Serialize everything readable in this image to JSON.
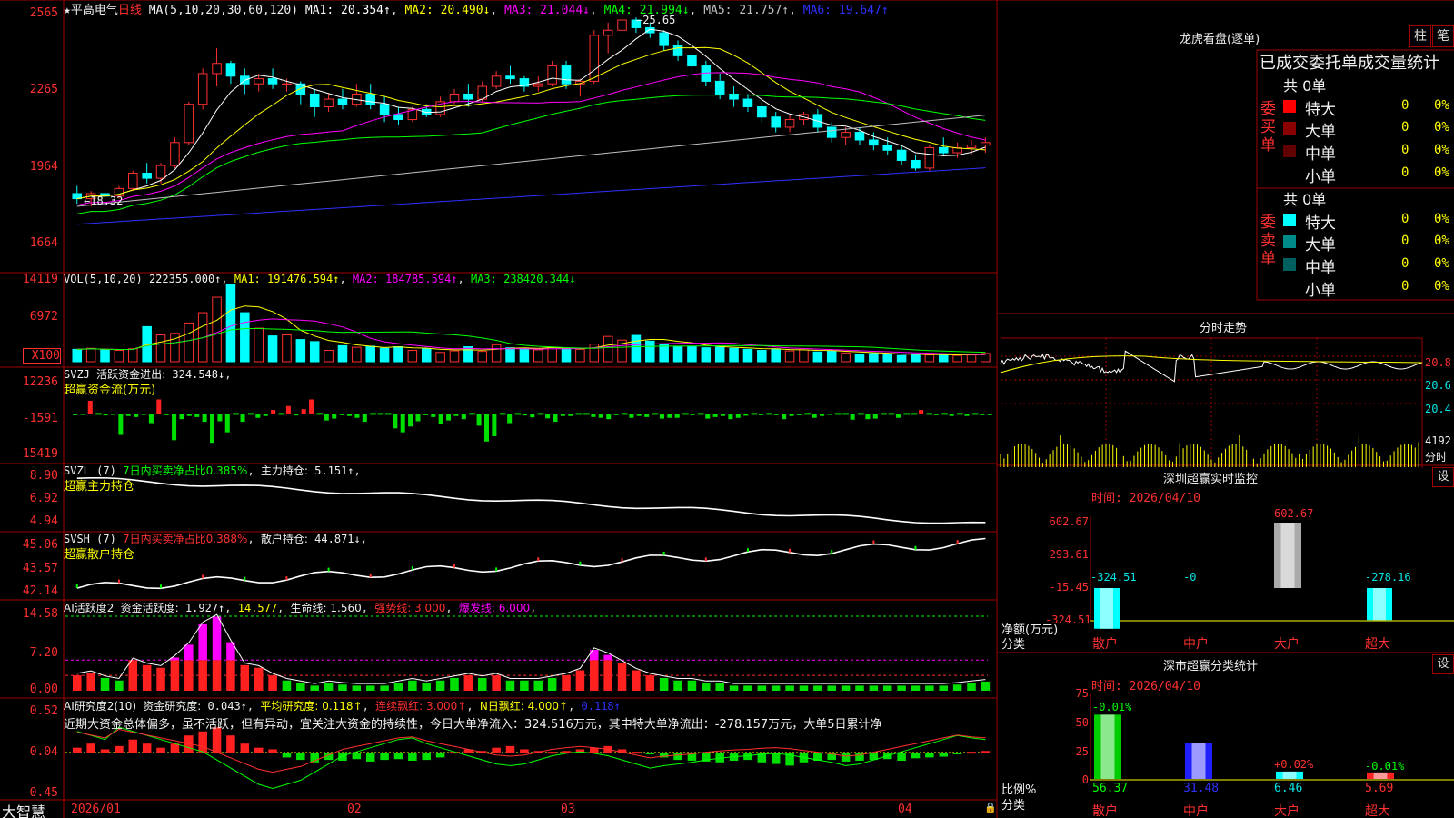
{
  "stock": {
    "star": "★",
    "name": "平高电气",
    "period": "日线"
  },
  "main": {
    "ma_label": "MA(5,10,20,30,60,120)",
    "mas": [
      {
        "label": "MA1: 20.354↑",
        "color": "#ffffff"
      },
      {
        "label": "MA2: 20.490↓",
        "color": "#ffff00"
      },
      {
        "label": "MA3: 21.044↓",
        "color": "#ff00ff"
      },
      {
        "label": "MA4: 21.994↓",
        "color": "#00ff00"
      },
      {
        "label": "MA5: 21.757↑",
        "color": "#c0c0c0"
      },
      {
        "label": "MA6: 19.647↑",
        "color": "#3030ff"
      }
    ],
    "y_ticks": [
      "2565",
      "2265",
      "1964",
      "1664"
    ],
    "high_mark": "25.65",
    "low_mark": "18.32",
    "candles": [
      [
        18.6,
        18.9,
        18.2,
        18.4
      ],
      [
        18.4,
        18.7,
        18.1,
        18.6
      ],
      [
        18.6,
        18.8,
        18.3,
        18.5
      ],
      [
        18.5,
        18.9,
        18.4,
        18.8
      ],
      [
        18.8,
        19.5,
        18.7,
        19.4
      ],
      [
        19.4,
        19.8,
        19.0,
        19.2
      ],
      [
        19.2,
        19.8,
        19.0,
        19.7
      ],
      [
        19.7,
        20.8,
        19.6,
        20.6
      ],
      [
        20.6,
        22.2,
        20.5,
        22.1
      ],
      [
        22.1,
        23.5,
        21.9,
        23.3
      ],
      [
        23.3,
        24.3,
        22.8,
        23.7
      ],
      [
        23.7,
        23.8,
        22.9,
        23.2
      ],
      [
        23.2,
        23.5,
        22.5,
        22.9
      ],
      [
        22.9,
        23.3,
        22.6,
        23.1
      ],
      [
        23.1,
        23.5,
        22.7,
        22.9
      ],
      [
        22.9,
        23.1,
        22.6,
        22.9
      ],
      [
        22.9,
        23.0,
        22.1,
        22.5
      ],
      [
        22.5,
        22.7,
        21.6,
        22.0
      ],
      [
        22.0,
        22.5,
        21.8,
        22.3
      ],
      [
        22.3,
        22.7,
        21.9,
        22.1
      ],
      [
        22.1,
        22.9,
        22.0,
        22.5
      ],
      [
        22.5,
        22.9,
        21.9,
        22.1
      ],
      [
        22.1,
        22.4,
        21.4,
        21.7
      ],
      [
        21.7,
        22.0,
        21.3,
        21.5
      ],
      [
        21.5,
        22.0,
        21.4,
        21.9
      ],
      [
        21.9,
        22.1,
        21.6,
        21.7
      ],
      [
        21.7,
        22.4,
        21.6,
        22.2
      ],
      [
        22.2,
        22.7,
        22.1,
        22.5
      ],
      [
        22.5,
        22.9,
        22.0,
        22.3
      ],
      [
        22.3,
        23.0,
        22.2,
        22.8
      ],
      [
        22.8,
        23.4,
        22.7,
        23.2
      ],
      [
        23.2,
        23.6,
        22.9,
        23.1
      ],
      [
        23.1,
        23.2,
        22.6,
        22.8
      ],
      [
        22.8,
        23.2,
        22.6,
        22.9
      ],
      [
        22.9,
        23.8,
        22.8,
        23.6
      ],
      [
        23.6,
        23.8,
        22.7,
        22.9
      ],
      [
        22.9,
        23.1,
        22.4,
        23.0
      ],
      [
        23.0,
        25.0,
        22.9,
        24.8
      ],
      [
        24.8,
        25.3,
        24.1,
        25.0
      ],
      [
        25.0,
        25.65,
        24.8,
        25.4
      ],
      [
        25.4,
        25.5,
        24.9,
        25.1
      ],
      [
        25.1,
        25.3,
        24.7,
        24.9
      ],
      [
        24.9,
        25.0,
        24.2,
        24.4
      ],
      [
        24.4,
        24.6,
        23.8,
        24.0
      ],
      [
        24.0,
        24.1,
        23.3,
        23.6
      ],
      [
        23.6,
        23.8,
        22.8,
        23.0
      ],
      [
        23.0,
        23.3,
        22.3,
        22.5
      ],
      [
        22.5,
        22.8,
        22.0,
        22.3
      ],
      [
        22.3,
        22.5,
        21.8,
        22.0
      ],
      [
        22.0,
        22.2,
        21.4,
        21.6
      ],
      [
        21.6,
        21.8,
        21.0,
        21.2
      ],
      [
        21.2,
        21.7,
        21.0,
        21.5
      ],
      [
        21.5,
        21.8,
        21.3,
        21.7
      ],
      [
        21.7,
        21.9,
        21.0,
        21.2
      ],
      [
        21.2,
        21.4,
        20.6,
        20.8
      ],
      [
        20.8,
        21.2,
        20.5,
        21.0
      ],
      [
        21.0,
        21.2,
        20.5,
        20.7
      ],
      [
        20.7,
        21.0,
        20.3,
        20.5
      ],
      [
        20.5,
        20.8,
        20.1,
        20.3
      ],
      [
        20.3,
        20.5,
        19.7,
        19.9
      ],
      [
        19.9,
        20.1,
        19.5,
        19.6
      ],
      [
        19.6,
        20.5,
        19.5,
        20.4
      ],
      [
        20.4,
        20.8,
        20.1,
        20.2
      ],
      [
        20.2,
        20.6,
        20.0,
        20.4
      ],
      [
        20.4,
        20.7,
        20.1,
        20.5
      ],
      [
        20.5,
        20.8,
        20.2,
        20.6
      ]
    ]
  },
  "vol": {
    "label": "VOL(5,10,20)",
    "value": "222355.000↑",
    "ma1": "MA1: 191476.594↑",
    "ma2": "MA2: 184785.594↑",
    "ma3": "MA3: 238420.344↓",
    "y_ticks": [
      "14119",
      "6972"
    ],
    "unit": "X100",
    "values": [
      2400,
      2600,
      2300,
      2200,
      2500,
      6800,
      5200,
      5500,
      7500,
      9500,
      12500,
      15000,
      9500,
      6500,
      5000,
      5200,
      4300,
      3900,
      2200,
      3100,
      2800,
      3000,
      2600,
      2900,
      2200,
      2500,
      1800,
      2100,
      2900,
      2000,
      3300,
      2700,
      2600,
      2300,
      2800,
      2600,
      2400,
      3400,
      4900,
      4200,
      5100,
      4000,
      3400,
      3000,
      2900,
      2700,
      2800,
      2600,
      2400,
      2200,
      2500,
      2100,
      2300,
      1900,
      2100,
      1700,
      1500,
      1600,
      1400,
      1200,
      1500,
      1300,
      1400,
      1200,
      1300,
      1600
    ]
  },
  "svzj": {
    "label": "SVZJ",
    "title": "活跃资金进出:",
    "value": "324.548↓",
    "subtitle": "超赢资金流(万元)",
    "y_ticks": [
      "12236",
      "-1591",
      "-15419"
    ],
    "values": [
      -500,
      -400,
      5000,
      -300,
      -600,
      -400,
      -8000,
      -800,
      -1200,
      -400,
      -3500,
      5500,
      -500,
      -10000,
      -2000,
      -800,
      -1200,
      -3000,
      -11000,
      -2800,
      -7000,
      -200,
      -3000,
      -300,
      -1500,
      -800,
      1500,
      -200,
      3000,
      -600,
      1800,
      5500,
      -300,
      -2500,
      -1800,
      -500,
      -800,
      -1500,
      -3000,
      -300,
      -200,
      -300,
      -5500,
      -7000,
      -4800,
      -2800,
      -500,
      -1200,
      -4000,
      -2500,
      -800,
      -2000,
      -300,
      -4500,
      -10500,
      -8500,
      -200,
      -3500,
      -200,
      -600,
      -1300,
      -200,
      -1700,
      -3000,
      -800,
      -800,
      -200,
      -300,
      -1200,
      -1500,
      -2000,
      -500,
      -300,
      -1500,
      -800,
      -1200,
      -300,
      -1800,
      -1500,
      -1500,
      -300,
      -500,
      -200,
      -1800,
      -1200,
      -800,
      -2000,
      -1500,
      -700,
      -300,
      -500,
      -300,
      -500,
      -2000,
      -800,
      -500,
      -300,
      -1500,
      -800,
      -400,
      -300,
      -300,
      -2200,
      -200,
      -2000,
      -1800,
      -300,
      -200,
      -1500,
      -300,
      -200,
      1500,
      -200,
      -500,
      -200,
      -800,
      -200,
      -800,
      -300,
      -500,
      -500
    ]
  },
  "svzl": {
    "label": "SVZL (7)",
    "note": "7日内买卖净占比0.385%",
    "title": "主力持仓:",
    "value": "5.151↑",
    "subtitle": "超赢主力持仓",
    "y_ticks": [
      "8.90",
      "6.92",
      "4.94"
    ]
  },
  "svsh": {
    "label": "SVSH (7)",
    "note": "7日内买卖净占比0.388%",
    "title": "散户持仓:",
    "value": "44.871↓",
    "subtitle": "超赢散户持仓",
    "y_ticks": [
      "45.06",
      "43.57",
      "42.14"
    ]
  },
  "ai": {
    "label": "AI活跃度2",
    "title": "资金活跃度:",
    "value": "1.927↑",
    "v2": "14.577",
    "life": "生命线: 1.560",
    "strong": "强势线: 3.000",
    "burst": "爆发线: 6.000",
    "y_ticks": [
      "14.58",
      "7.20",
      "0.00"
    ]
  },
  "ai2": {
    "label": "AI研究度2(10)",
    "title": "资金研究度:",
    "value": "0.043↑",
    "avg": "平均研究度: 0.118↑",
    "lianxu": "连续飘红: 3.000↑",
    "nday": "N日飘红: 4.000↑",
    "last": "0.118↑",
    "comment": "近期大资金总体偏多，虽不活跃，但有异动，宜关注大资金的持续性，今日大单净流入：324.516万元，其中特大单净流出：-278.157万元，大单5日累计净",
    "y_ticks": [
      "0.52",
      "0.04",
      "-0.45"
    ]
  },
  "xaxis": {
    "brand": "大智慧",
    "labels": [
      "2026/01",
      "02",
      "03",
      "04"
    ]
  },
  "right": {
    "longhu_title": "龙虎看盘(逐单)",
    "btn_zhu": "柱",
    "btn_bi": "笔",
    "stats_title": "已成交委托单成交量统计",
    "buy_side": "委买单",
    "sell_side": "委卖单",
    "buy_total": "共 0单",
    "sell_total": "共 0单",
    "rows": [
      {
        "label": "特大",
        "qty": "0",
        "pct": "0%"
      },
      {
        "label": "大单",
        "qty": "0",
        "pct": "0%"
      },
      {
        "label": "中单",
        "qty": "0",
        "pct": "0%"
      },
      {
        "label": "小单",
        "qty": "0",
        "pct": "0%"
      }
    ],
    "buy_colors": [
      "#ff0000",
      "#8b0000",
      "#600000"
    ],
    "sell_colors": [
      "#00ffff",
      "#008b8b",
      "#006060"
    ],
    "intraday_title": "分时走势",
    "intraday_ticks": [
      "20.8",
      "20.6",
      "20.4"
    ],
    "intraday_vol": "4192",
    "intraday_unit": "分时",
    "monitor_title": "深圳超赢实时监控",
    "btn_set": "设",
    "monitor_time": "时间: 2026/04/10",
    "monitor_ticks": [
      "602.67",
      "293.61",
      "-15.45",
      "-324.51"
    ],
    "monitor_ylabel": "净额(万元)",
    "monitor_xlabel": "分类",
    "monitor_bars": [
      {
        "cat": "散户",
        "value": "-324.51"
      },
      {
        "cat": "中户",
        "value": "-0"
      },
      {
        "cat": "大户",
        "value": "602.67"
      },
      {
        "cat": "超大",
        "value": "-278.16"
      }
    ],
    "class_title": "深市超赢分类统计",
    "class_time": "时间: 2026/04/10",
    "class_ticks": [
      "75",
      "50",
      "25",
      "0"
    ],
    "class_ylabel": "比例%",
    "class_xlabel": "分类",
    "class_bars": [
      {
        "cat": "散户",
        "value": "56.37",
        "delta": "-0.01%"
      },
      {
        "cat": "中户",
        "value": "31.48",
        "delta": ""
      },
      {
        "cat": "大户",
        "value": "6.46",
        "delta": "+0.02%"
      },
      {
        "cat": "超大",
        "value": "5.69",
        "delta": "-0.01%"
      }
    ]
  }
}
